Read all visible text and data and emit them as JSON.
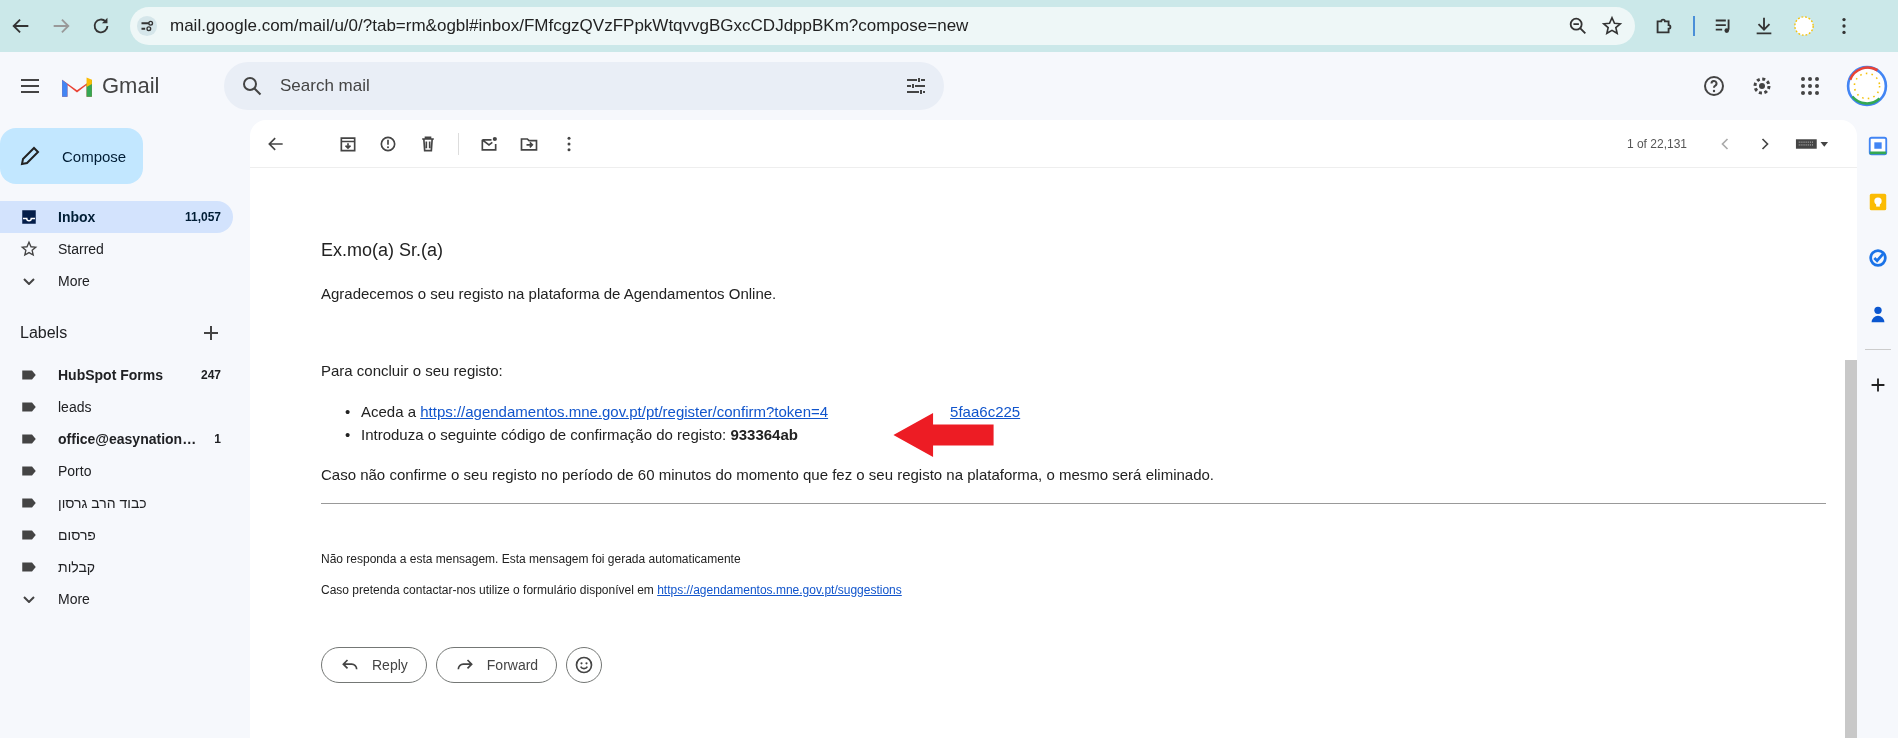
{
  "browser": {
    "url": "mail.google.com/mail/u/0/?tab=rm&ogbl#inbox/FMfcgzQVzFPpkWtqvvgBGxcCDJdppBKm?compose=new"
  },
  "header": {
    "app_name": "Gmail",
    "search": {
      "placeholder": "Search mail"
    }
  },
  "sidebar": {
    "compose": "Compose",
    "items": [
      {
        "label": "Inbox",
        "count": "11,057",
        "selected": true,
        "kind": "inbox"
      },
      {
        "label": "Starred",
        "selected": false,
        "kind": "star"
      },
      {
        "label": "More",
        "selected": false,
        "kind": "more"
      }
    ],
    "labels_heading": "Labels",
    "labels": [
      {
        "name": "HubSpot Forms",
        "count": "247",
        "unread": true
      },
      {
        "name": "leads",
        "unread": false
      },
      {
        "name": "office@easynation…",
        "count": "1",
        "unread": true
      },
      {
        "name": "Porto",
        "unread": false
      },
      {
        "name": "כבוד הרב גרסון",
        "unread": false
      },
      {
        "name": "פרסום",
        "unread": false
      },
      {
        "name": "קבלות",
        "unread": false
      }
    ],
    "labels_more": "More"
  },
  "toolbar": {
    "pager": "1 of 22,131"
  },
  "email": {
    "greeting": "Ex.mo(a) Sr.(a)",
    "intro": "Agradecemos o seu registo na plataforma de Agendamentos Online.",
    "steps_heading": "Para concluir o seu registo:",
    "steps": [
      {
        "kind": "link",
        "marker": "•",
        "text": "Aceda a",
        "link_parts": [
          "https://agendamentos.mne.gov.pt/pt/register/confirm?token=4",
          "5faa6c225"
        ]
      },
      {
        "kind": "code",
        "marker": "•",
        "text": "Introduza o seguinte código de confirmação do registo: **933364ab**"
      }
    ],
    "warning": "Caso não confirme o seu registo no período de 60 minutos do momento que fez o seu registo na plataforma, o mesmo será eliminado.",
    "footer_note": "Não responda a esta mensagem. Esta mensagem foi gerada automaticamente",
    "contact": {
      "text": "Caso pretenda contactar-nos utilize o formulário disponível em",
      "link": "https://agendamentos.mne.gov.pt/suggestions"
    }
  },
  "actions": [
    "Reply",
    "Forward"
  ]
}
